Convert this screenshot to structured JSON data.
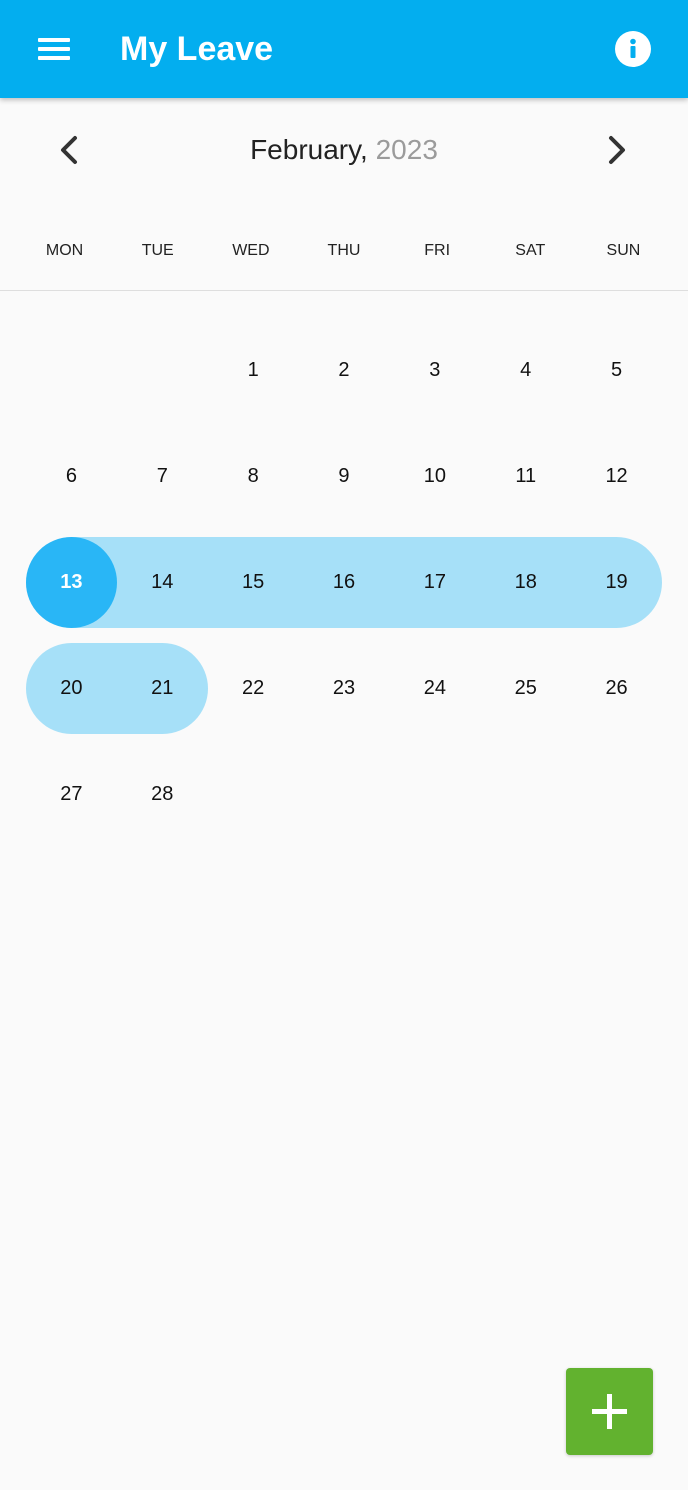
{
  "app_bar": {
    "title": "My Leave",
    "color": "#03aeef"
  },
  "calendar": {
    "month": "February,",
    "year": "2023",
    "weekdays": [
      "MON",
      "TUE",
      "WED",
      "THU",
      "FRI",
      "SAT",
      "SUN"
    ],
    "weeks": [
      [
        "",
        "",
        "1",
        "2",
        "3",
        "4",
        "5"
      ],
      [
        "6",
        "7",
        "8",
        "9",
        "10",
        "11",
        "12"
      ],
      [
        "13",
        "14",
        "15",
        "16",
        "17",
        "18",
        "19"
      ],
      [
        "20",
        "21",
        "22",
        "23",
        "24",
        "25",
        "26"
      ],
      [
        "27",
        "28",
        "",
        "",
        "",
        "",
        ""
      ]
    ],
    "selected_start": "13",
    "range_days": [
      "13",
      "14",
      "15",
      "16",
      "17",
      "18",
      "19",
      "20",
      "21"
    ],
    "range_color": "#a6e0f8",
    "selected_color": "#29b6f6"
  },
  "fab": {
    "icon": "plus-icon",
    "color": "#62b22f"
  },
  "icons": {
    "menu": "menu-icon",
    "info": "info-icon",
    "prev": "chevron-left-icon",
    "next": "chevron-right-icon"
  }
}
